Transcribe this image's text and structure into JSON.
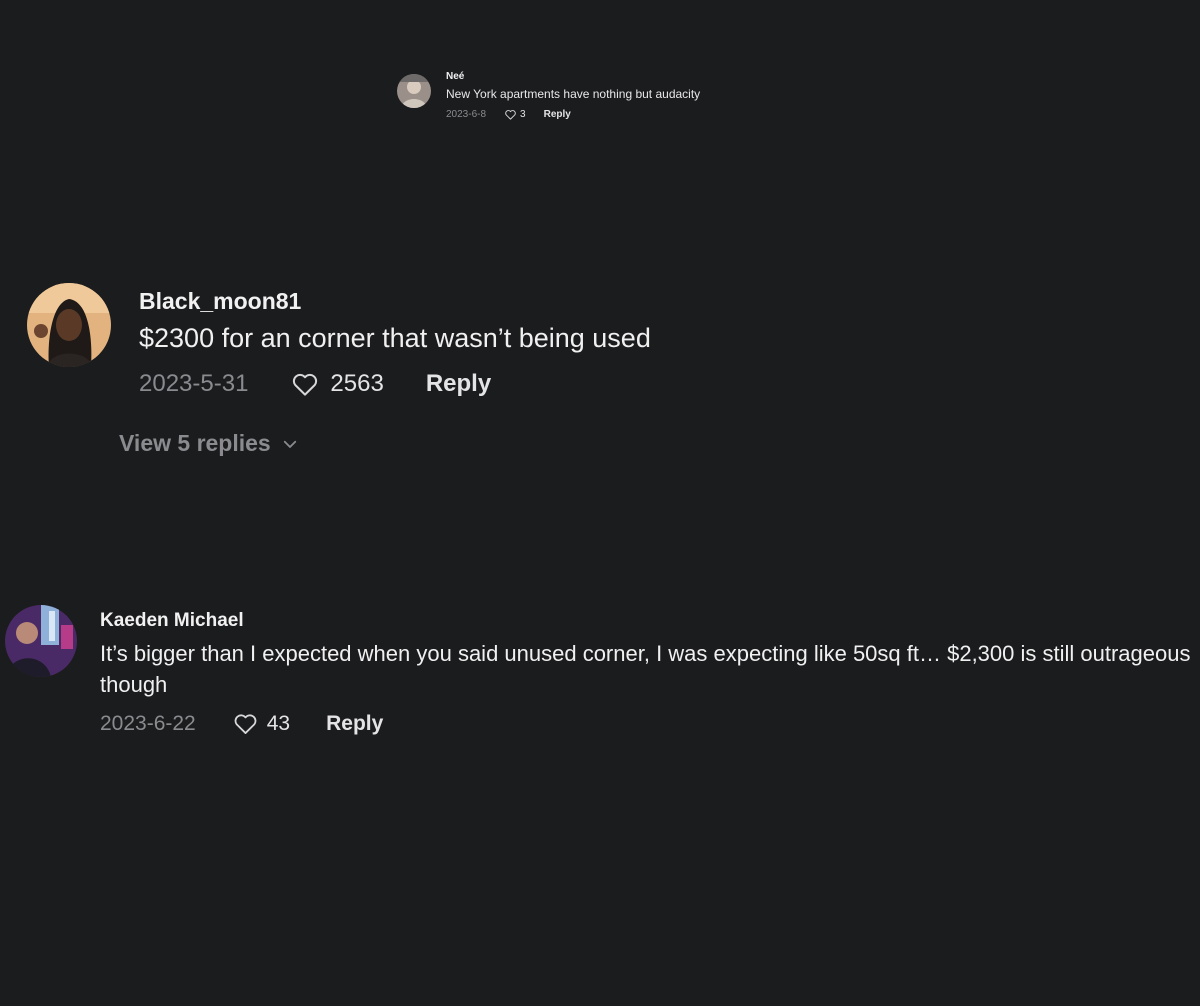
{
  "comments": [
    {
      "username": "Neé",
      "text": "New York apartments have nothing but audacity",
      "date": "2023-6-8",
      "likes": "3",
      "reply_label": "Reply",
      "avatar_icon": "user-avatar"
    },
    {
      "username": "Black_moon81",
      "text": "$2300 for an corner that wasn’t being used",
      "date": "2023-5-31",
      "likes": "2563",
      "reply_label": "Reply",
      "view_replies_label": "View 5 replies",
      "avatar_icon": "user-avatar"
    },
    {
      "username": "Kaeden Michael",
      "text": "It’s bigger than I expected when you said unused corner, I was expecting like 50sq ft… $2,300 is still outrageous though",
      "date": "2023-6-22",
      "likes": "43",
      "reply_label": "Reply",
      "avatar_icon": "user-avatar"
    }
  ],
  "icons": {
    "like": "heart-outline-icon",
    "expand": "chevron-down-icon"
  },
  "colors": {
    "background": "#1b1c1e",
    "text_primary": "#f1f1f2",
    "text_secondary": "#8a8b8f"
  }
}
